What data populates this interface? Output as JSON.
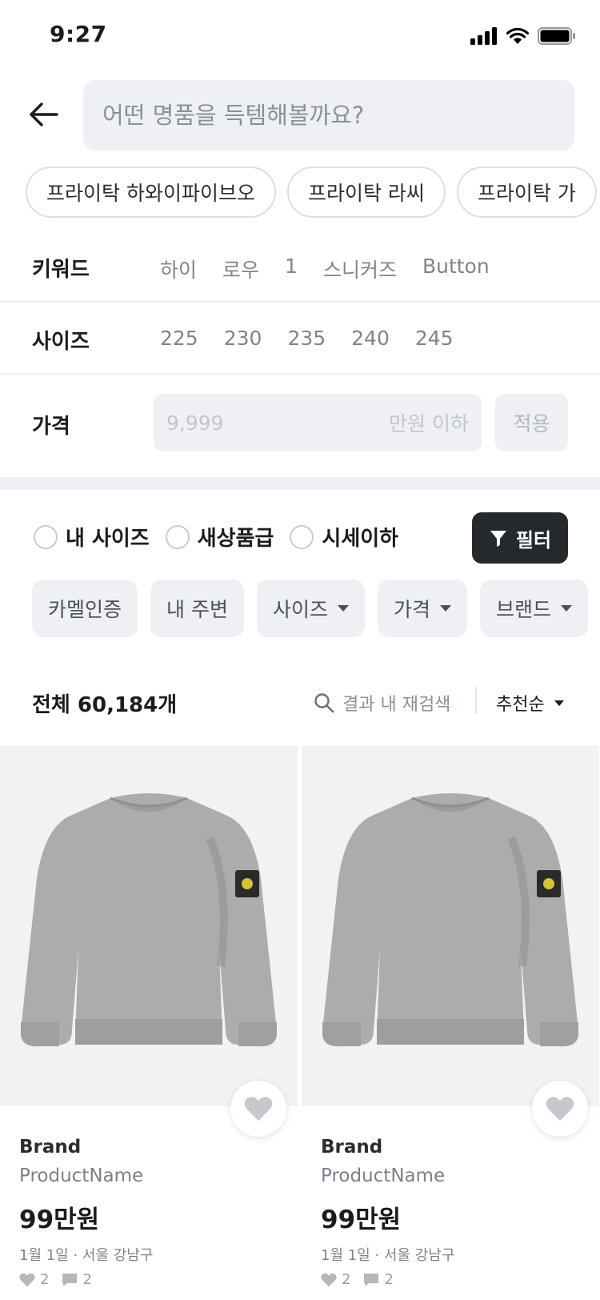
{
  "status_bar": {
    "time": "9:27"
  },
  "search": {
    "placeholder": "어떤 명품을 득템해볼까요?"
  },
  "suggestions": [
    "프라이탁 하와이파이브오",
    "프라이탁 라씨",
    "프라이탁 가"
  ],
  "keyword_row": {
    "label": "키워드",
    "values": [
      "하이",
      "로우",
      "1",
      "스니커즈",
      "Button"
    ]
  },
  "size_row": {
    "label": "사이즈",
    "values": [
      "225",
      "230",
      "235",
      "240",
      "245"
    ]
  },
  "price_row": {
    "label": "가격",
    "input_placeholder": "9,999",
    "unit": "만원 이하",
    "apply_label": "적용"
  },
  "radio_filters": [
    "내 사이즈",
    "새상품급",
    "시세이하"
  ],
  "filter_button_label": "필터",
  "tag_chips": [
    {
      "label": "카멜인증",
      "dropdown": false
    },
    {
      "label": "내 주변",
      "dropdown": false
    },
    {
      "label": "사이즈",
      "dropdown": true
    },
    {
      "label": "가격",
      "dropdown": true
    },
    {
      "label": "브랜드",
      "dropdown": true
    }
  ],
  "results": {
    "count_label": "전체 60,184개",
    "research_label": "결과 내 재검색",
    "sort_label": "추천순"
  },
  "products": [
    {
      "brand": "Brand",
      "name": "ProductName",
      "price": "99만원",
      "meta": "1월 1일 · 서울 강남구",
      "likes": "2",
      "comments": "2"
    },
    {
      "brand": "Brand",
      "name": "ProductName",
      "price": "99만원",
      "meta": "1월 1일 · 서울 강남구",
      "likes": "2",
      "comments": "2"
    }
  ]
}
